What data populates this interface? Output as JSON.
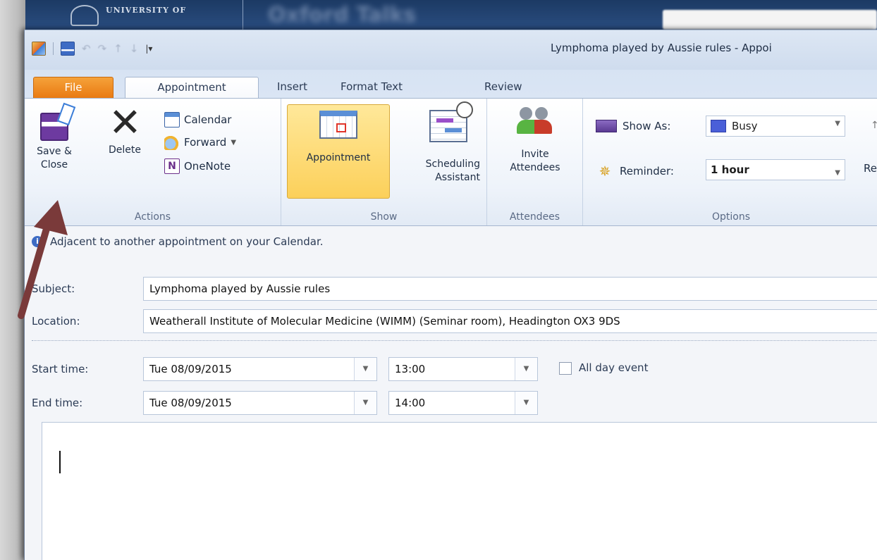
{
  "background": {
    "university_text": "UNIVERSITY OF",
    "blurred_title": "Oxford Talks"
  },
  "window": {
    "title": "Lymphoma played by Aussie rules  -  Appoi",
    "qat_customize": "|▾"
  },
  "tabs": [
    {
      "label": "File"
    },
    {
      "label": "Appointment"
    },
    {
      "label": "Insert"
    },
    {
      "label": "Format Text"
    },
    {
      "label": "Review"
    }
  ],
  "ribbon": {
    "actions": {
      "save_close": "Save &\nClose",
      "delete": "Delete",
      "calendar": "Calendar",
      "forward": "Forward",
      "onenote": "OneNote",
      "group_label": "Actions"
    },
    "show": {
      "appointment": "Appointment",
      "scheduling": "Scheduling\nAssistant",
      "group_label": "Show"
    },
    "attendees": {
      "invite": "Invite\nAttendees",
      "group_label": "Attendees"
    },
    "options": {
      "show_as_label": "Show As:",
      "show_as_value": "Busy",
      "reminder_label": "Reminder:",
      "reminder_value": "1 hour",
      "recurrence_partial": "Rec",
      "group_label": "Options"
    }
  },
  "form": {
    "info_message": "Adjacent to another appointment on your Calendar.",
    "subject_label": "Subject:",
    "subject_value": "Lymphoma played by Aussie rules",
    "location_label": "Location:",
    "location_value": "Weatherall Institute of Molecular Medicine (WIMM) (Seminar room), Headington OX3 9DS",
    "start_label": "Start time:",
    "start_date": "Tue 08/09/2015",
    "start_time": "13:00",
    "all_day_label": "All day event",
    "end_label": "End time:",
    "end_date": "Tue 08/09/2015",
    "end_time": "14:00"
  },
  "colors": {
    "file_tab": "#e97a12",
    "active_view": "#fcd05a",
    "annotation_arrow": "#7a3a3a",
    "busy": "#4a5fd8"
  }
}
